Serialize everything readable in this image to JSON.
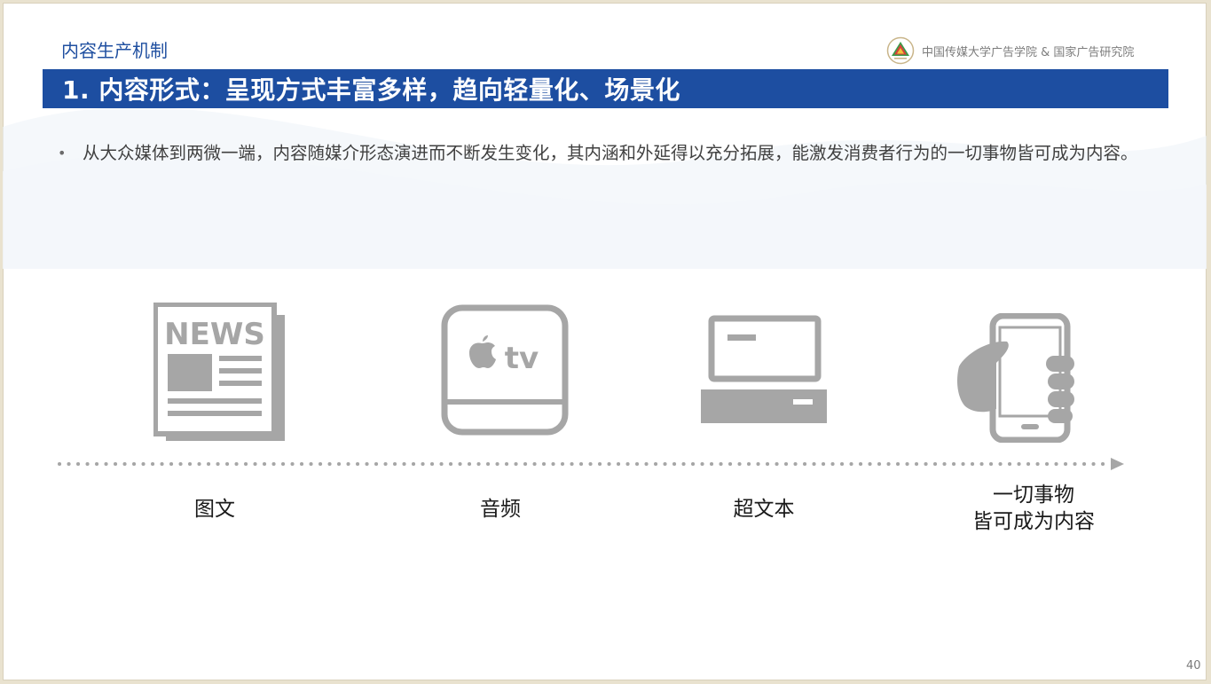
{
  "header": {
    "section": "内容生产机制",
    "org": "中国传媒大学广告学院 & 国家广告研究院"
  },
  "title": "1. 内容形式：呈现方式丰富多样，趋向轻量化、场景化",
  "bullet": "从大众媒体到两微一端，内容随媒介形态演进而不断发生变化，其内涵和外延得以充分拓展，能激发消费者行为的一切事物皆可成为内容。",
  "icons": {
    "newspaper_text": "NEWS",
    "tv_text": "tv"
  },
  "stages": [
    {
      "line1": "图文",
      "line2": ""
    },
    {
      "line1": "音频",
      "line2": ""
    },
    {
      "line1": "超文本",
      "line2": ""
    },
    {
      "line1": "一切事物",
      "line2": "皆可成为内容"
    }
  ],
  "page_number": "40",
  "colors": {
    "title_bar": "#1d4ea1",
    "section_text": "#1f4fa0",
    "icon_gray": "#a6a6a6"
  }
}
